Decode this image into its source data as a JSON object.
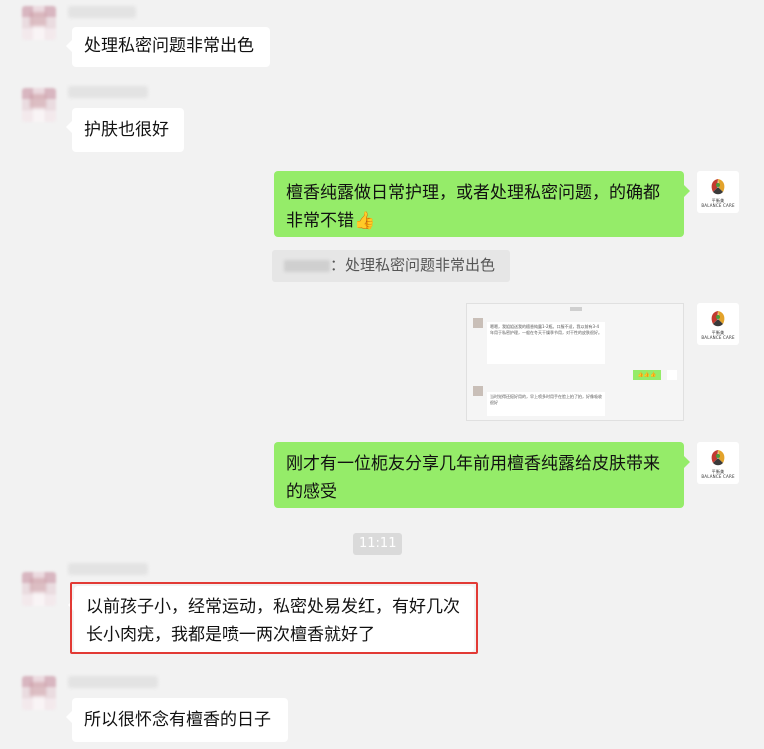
{
  "messages": {
    "m1": "处理私密问题非常出色",
    "m2": "护肤也很好",
    "m3": "檀香纯露做日常护理，或者处理私密问题，的确都非常不错",
    "m3_emoji": "👍",
    "quote": "：处理私密问题非常出色",
    "m5": "刚才有一位枙友分享几年前用檀香纯露给皮肤带来的感受",
    "m6": "以前孩子小，经常运动，私密处易发红，有好几次长小肉疣，我都是喷一两次檀香就好了",
    "m7": "所以很怀念有檀香的日子"
  },
  "timestamp": "11:11",
  "brand": {
    "cn": "平衡美",
    "en": "BALANCE CARE"
  },
  "thumbnail": {
    "text1": "嗯嗯，我姐姐送我的檀香纯露1-2瓶。口服不适，我以前有3-4年用于私密护理，一般在冬天干燥季节用，对干性的皮肤很好。",
    "text2": "当时觉得还挺好用的，早上喷多时用手在脸上拍了拍，好像吸收很好",
    "emoji": "👍👍👍"
  },
  "colors": {
    "background": "#f2f2f2",
    "bubble_green": "#95ec69",
    "bubble_white": "#ffffff",
    "highlight": "#e23a35"
  }
}
